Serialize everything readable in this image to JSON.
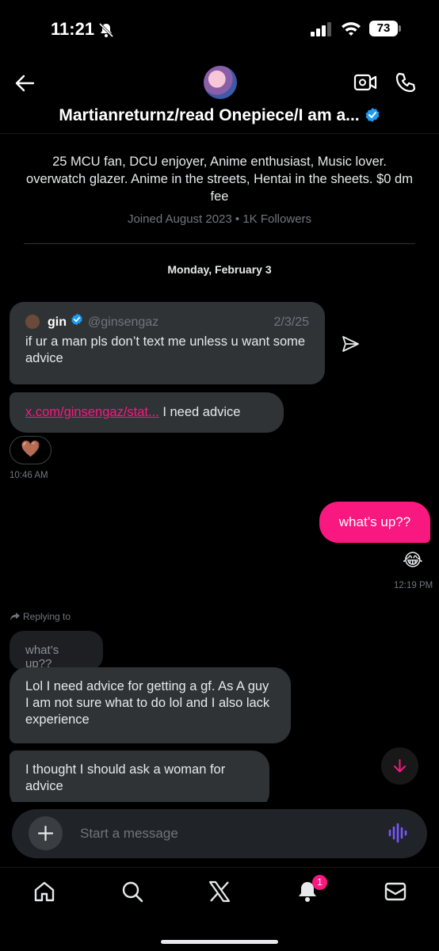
{
  "status_bar": {
    "time": "11:21",
    "battery": "73"
  },
  "header": {
    "title": "Martianreturnz/read Onepiece/I am a...",
    "bio": "25 MCU fan, DCU enjoyer, Anime enthusiast, Music lover. overwatch glazer. Anime in the streets, Hentai in the sheets. $0 dm fee",
    "meta": "Joined August 2023 • 1K Followers"
  },
  "conversation": {
    "date_separator": "Monday, February 3",
    "quoted_post": {
      "name": "gin",
      "handle": "@ginsengaz",
      "date": "2/3/25",
      "text": "if ur a man pls don’t text me unless u want some advice"
    },
    "link_message": {
      "link": "x.com/ginsengaz/stat...",
      "text": " I need advice"
    },
    "reaction": "🤎",
    "time_1": "10:46 AM",
    "sent_message": "what’s up??",
    "sent_reaction": "😂",
    "time_2": "12:19 PM",
    "replying_to_label": "Replying to",
    "replied_text": "what’s up??",
    "message_2": "Lol I need advice for getting a gf. As  A guy I am not sure what to do lol and I also lack experience",
    "message_3": "I thought I should ask a woman for advice"
  },
  "composer": {
    "placeholder": "Start a message"
  },
  "nav": {
    "notification_count": "1"
  },
  "colors": {
    "accent": "#f91880",
    "verified": "#1d9bf0",
    "voice": "#7856ff",
    "bubble": "#2f3336"
  }
}
